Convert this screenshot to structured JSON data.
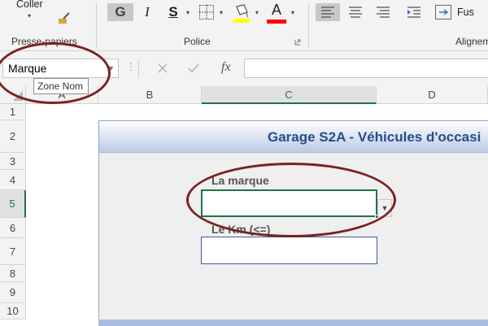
{
  "ribbon": {
    "paste_label": "Coller",
    "groups": {
      "clipboard": "Presse-papiers",
      "font": "Police",
      "alignment": "Alignem"
    },
    "bold_label": "G",
    "italic_label": "I",
    "underline_label": "S",
    "font_color_letter": "A",
    "merge_label": "Fus",
    "highlight_color": "#ffff00",
    "font_color": "#ff0000",
    "accent": "#217346"
  },
  "formula_bar": {
    "name_box_value": "Marque",
    "tooltip": "Zone Nom",
    "fx": "fx",
    "dots": "⋮"
  },
  "columns": [
    "A",
    "B",
    "C",
    "D"
  ],
  "selected_column": "C",
  "rows": [
    "1",
    "2",
    "3",
    "4",
    "5",
    "6",
    "7",
    "8",
    "9",
    "10"
  ],
  "selected_row": "5",
  "form": {
    "title": "Garage S2A - Véhicules d'occasi",
    "brand_label": "La marque",
    "brand_value": "",
    "km_label": "Le Km (<=)",
    "km_value": ""
  },
  "icons": {
    "paste": "clipboard-icon",
    "format_painter": "paintbrush-icon",
    "borders": "borders-icon",
    "fill_color": "paint-bucket-icon",
    "font_color": "font-color-icon",
    "align_left": "align-left-icon",
    "align_center": "align-center-icon",
    "align_right": "align-right-icon",
    "indent": "indent-icon",
    "wrap": "wrap-text-icon",
    "cancel": "cancel-icon",
    "confirm": "check-icon",
    "dialog_launcher": "dialog-launcher-icon"
  }
}
